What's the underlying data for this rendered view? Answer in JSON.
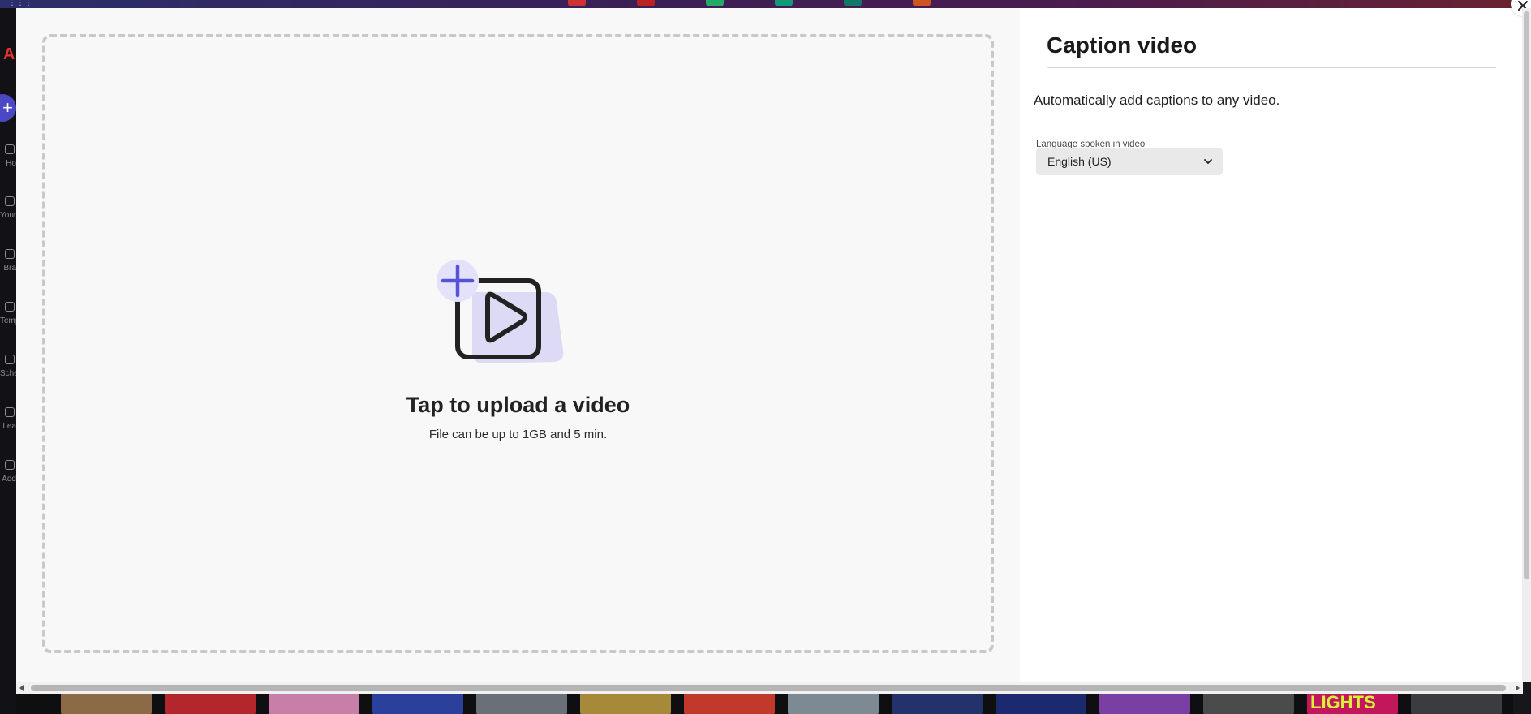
{
  "modal": {
    "title": "Caption video",
    "description": "Automatically add captions to any video.",
    "language_label": "Language spoken in video",
    "language_value": "English (US)",
    "upload_title": "Tap to upload a video",
    "upload_subtitle": "File can be up to 1GB and 5 min.",
    "close_icon": "close-icon"
  },
  "background": {
    "sidebar_labels": [
      "Ho",
      "Your",
      "Bra",
      "Temp",
      "Sche",
      "Lea",
      "Add"
    ],
    "thumb_text": "LIGHTS",
    "brand_color": "#e3342f",
    "create_button_color": "#4b48c6"
  },
  "colors": {
    "accent": "#5753d6",
    "illustration_back": "#dcdaf5"
  }
}
